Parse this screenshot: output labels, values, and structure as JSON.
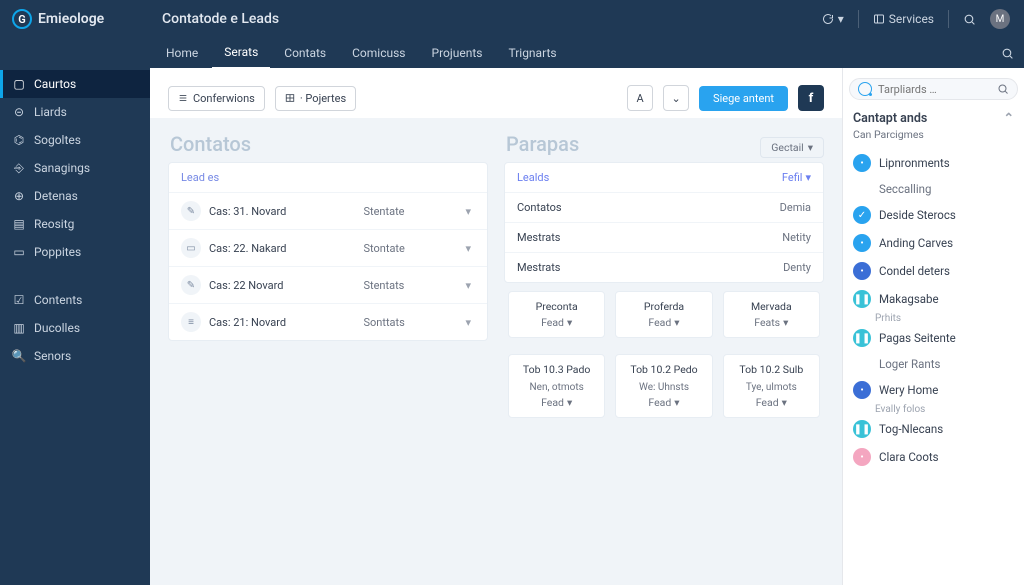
{
  "brand": {
    "name": "Emieologe",
    "initial": "G"
  },
  "pageTitle": "Contatode e Leads",
  "header": {
    "services": "Services",
    "avatarInitial": "M"
  },
  "tabs": [
    "Home",
    "Serats",
    "Contats",
    "Comicuss",
    "Projuents",
    "Trignarts"
  ],
  "activeTabIndex": 1,
  "sidebar": {
    "items": [
      "Caurtos",
      "Liards",
      "Sogoltes",
      "Sanagings",
      "Detenas",
      "Reositg",
      "Poppites"
    ],
    "items2": [
      "Contents",
      "Ducolles",
      "Senors"
    ]
  },
  "toolbar": {
    "conversions": "Conferwions",
    "projects": "· Pojertes",
    "letter": "A",
    "stage": "Siege antent",
    "fb": "f"
  },
  "rightPanel": {
    "searchPlaceholder": "Tarpliards …",
    "title": "Cantapt ands",
    "subtitle": "Can Parcigmes",
    "items": [
      {
        "type": "blue",
        "label": "Lipnronments"
      },
      {
        "type": "nolead",
        "label": "Seccalling"
      },
      {
        "type": "blue",
        "check": true,
        "label": "Deside Sterocs"
      },
      {
        "type": "blue",
        "label": "Anding Carves"
      },
      {
        "type": "dblue",
        "label": "Condel deters"
      },
      {
        "type": "teal",
        "label": "Makagsabe",
        "sub": "Prhits"
      },
      {
        "type": "teal",
        "label": "Pagas Seitente"
      },
      {
        "type": "nolead",
        "label": "Loger Rants"
      },
      {
        "type": "dblue",
        "label": "Wery Home",
        "sub": "Evally folos"
      },
      {
        "type": "teal",
        "label": "Tog-Nlecans"
      },
      {
        "type": "pink",
        "label": "Clara Coots"
      }
    ]
  },
  "col1": {
    "title": "Contatos",
    "head": "Lead es",
    "rows": [
      {
        "name": "Cas: 31. Novard",
        "status": "Stentate"
      },
      {
        "name": "Cas: 22. Nakard",
        "status": "Stontate"
      },
      {
        "name": "Cas: 22 Novard",
        "status": "Stentats"
      },
      {
        "name": "Cas: 21: Novard",
        "status": "Sonttats"
      }
    ]
  },
  "col2": {
    "title": "Parapas",
    "detail": "Gectail",
    "head": "Lealds",
    "headAction": "Fefil",
    "rows": [
      {
        "name": "Contatos",
        "val": "Demia"
      },
      {
        "name": "Mestrats",
        "val": "Netity"
      },
      {
        "name": "Mestrats",
        "val": "Denty"
      }
    ],
    "cards1": [
      {
        "title": "Preconta",
        "sub": "Fead"
      },
      {
        "title": "Proferda",
        "sub": "Fead"
      },
      {
        "title": "Mervada",
        "sub": "Feats"
      }
    ],
    "cards2": [
      {
        "top": "Tob 10.3 Pado",
        "mid": "Nen, otmots",
        "sub": "Fead"
      },
      {
        "top": "Tob 10.2 Pedo",
        "mid": "We: Uhnsts",
        "sub": "Fead"
      },
      {
        "top": "Tob 10.2 Sulb",
        "mid": "Tye, ulmots",
        "sub": "Fead"
      }
    ]
  }
}
